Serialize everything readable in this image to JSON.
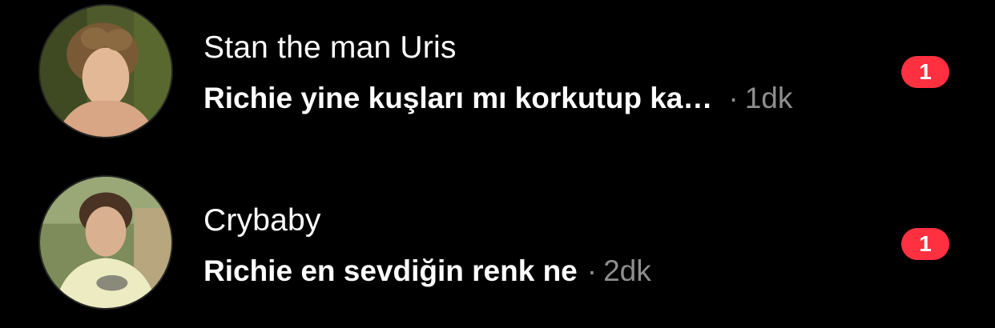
{
  "conversations": [
    {
      "name": "Stan the man Uris",
      "preview": "Richie yine kuşları mı korkutup ka…",
      "separator": "·",
      "time": "1dk",
      "unread_count": "1"
    },
    {
      "name": "Crybaby",
      "preview": "Richie en sevdiğin renk ne",
      "separator": "·",
      "time": "2dk",
      "unread_count": "1"
    }
  ],
  "colors": {
    "background": "#000000",
    "text_primary": "#ffffff",
    "text_secondary": "#8e8e8e",
    "badge": "#ff3040"
  }
}
